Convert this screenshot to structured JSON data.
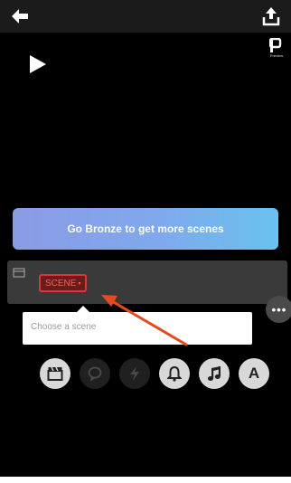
{
  "colors": {
    "background": "#000000",
    "topbar": "#1b1b1b",
    "banner_start": "#8b9be6",
    "banner_end": "#69c2ee",
    "scene_strip": "#3a3a3a",
    "scene_dropdown_border": "#e53232",
    "scene_dropdown_text": "#ff5c5c",
    "annotation_arrow": "#e8491d",
    "tool_enabled": "#d8d8d8",
    "tool_disabled": "#202020"
  },
  "topbar": {
    "back_icon": "arrow-left-icon",
    "export_icon": "export-upload-icon"
  },
  "preview": {
    "play_icon": "play-icon",
    "mode_icon": "preview-mode-icon",
    "mode_label": "Preview"
  },
  "banner": {
    "label": "Go Bronze to get more scenes"
  },
  "scene": {
    "clapper_icon": "clapperboard-icon",
    "dropdown_label": "SCENE",
    "dropdown_caret": "▾"
  },
  "more_button": {
    "label": "•••",
    "icon": "more-options-icon"
  },
  "tooltip": {
    "text": "Choose a scene"
  },
  "toolbar": {
    "tools": [
      {
        "name": "scene",
        "icon": "clapperboard-icon",
        "enabled": true
      },
      {
        "name": "speech",
        "icon": "speech-bubble-icon",
        "enabled": false
      },
      {
        "name": "action",
        "icon": "lightning-icon",
        "enabled": false
      },
      {
        "name": "sound-effect",
        "icon": "bell-icon",
        "enabled": true
      },
      {
        "name": "music",
        "icon": "music-note-icon",
        "enabled": true
      },
      {
        "name": "text",
        "icon": "text-icon",
        "label": "A",
        "enabled": true
      }
    ]
  }
}
